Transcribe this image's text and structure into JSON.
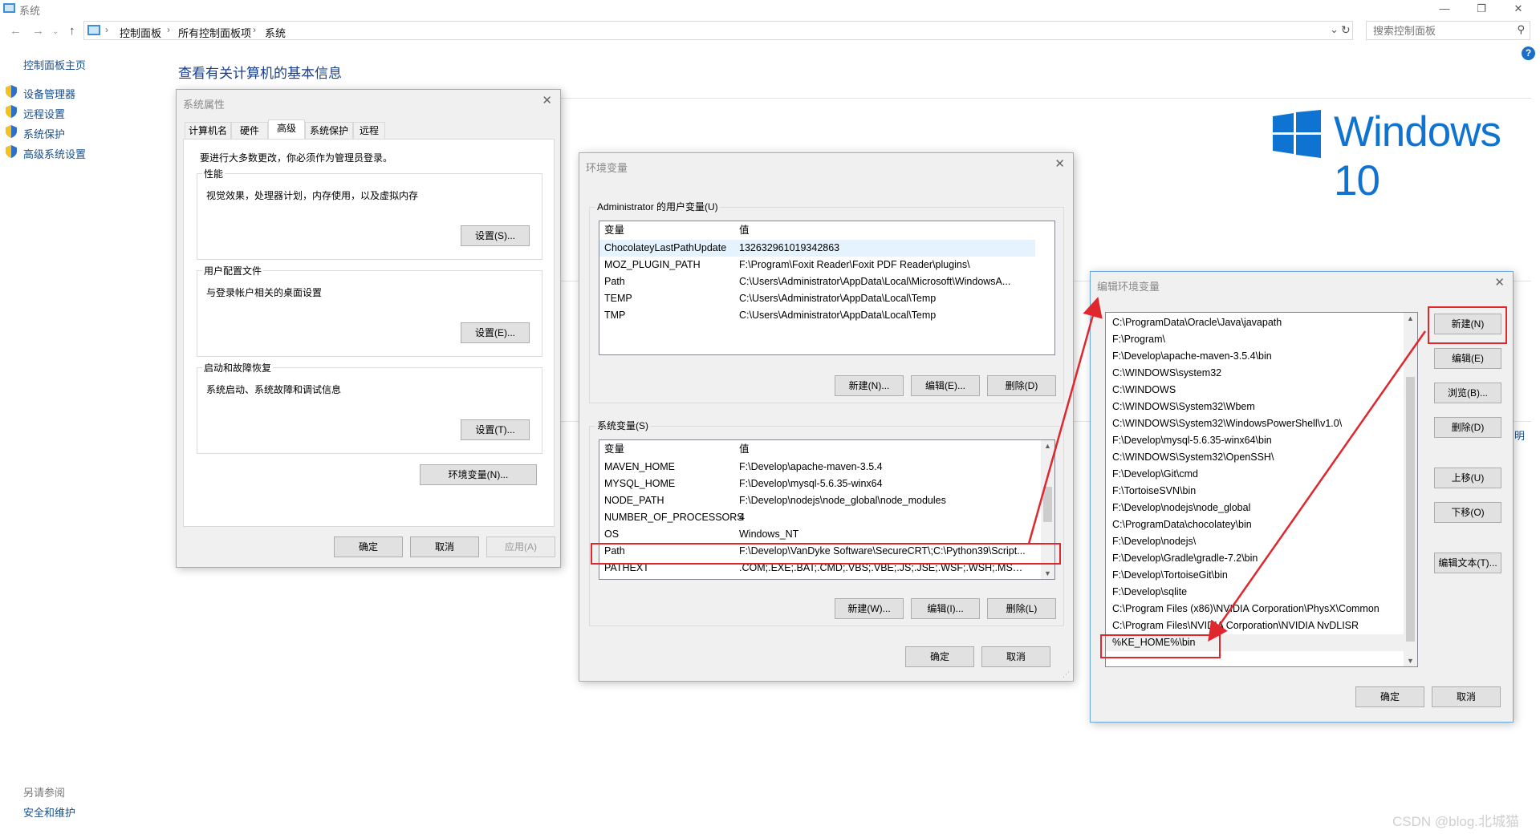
{
  "window": {
    "title": "系统",
    "controls": [
      "—",
      "❐",
      "✕"
    ]
  },
  "address": {
    "crumbs": [
      "控制面板",
      "所有控制面板项",
      "系统"
    ],
    "search_placeholder": "搜索控制面板"
  },
  "left_panel": {
    "home": "控制面板主页",
    "items": [
      "设备管理器",
      "远程设置",
      "系统保护",
      "高级系统设置"
    ],
    "see_also_title": "另请参阅",
    "see_also_items": [
      "安全和维护"
    ]
  },
  "main": {
    "title": "查看有关计算机的基本信息",
    "brand": "Windows 10",
    "edge_text": "明",
    "watermark": "CSDN @blog.北城猫"
  },
  "sysprops": {
    "title": "系统属性",
    "tabs": [
      "计算机名",
      "硬件",
      "高级",
      "系统保护",
      "远程"
    ],
    "active_tab": "高级",
    "admin_note": "要进行大多数更改，你必须作为管理员登录。",
    "groups": [
      {
        "title": "性能",
        "desc": "视觉效果，处理器计划，内存使用，以及虚拟内存",
        "button": "设置(S)..."
      },
      {
        "title": "用户配置文件",
        "desc": "与登录帐户相关的桌面设置",
        "button": "设置(E)..."
      },
      {
        "title": "启动和故障恢复",
        "desc": "系统启动、系统故障和调试信息",
        "button": "设置(T)..."
      }
    ],
    "env_button": "环境变量(N)...",
    "ok": "确定",
    "cancel": "取消",
    "apply": "应用(A)"
  },
  "envvars": {
    "title": "环境变量",
    "user_group": "Administrator 的用户变量(U)",
    "col_var": "变量",
    "col_val": "值",
    "user_vars": [
      {
        "name": "ChocolateyLastPathUpdate",
        "value": "132632961019342863"
      },
      {
        "name": "MOZ_PLUGIN_PATH",
        "value": "F:\\Program\\Foxit Reader\\Foxit PDF Reader\\plugins\\"
      },
      {
        "name": "Path",
        "value": "C:\\Users\\Administrator\\AppData\\Local\\Microsoft\\WindowsA..."
      },
      {
        "name": "TEMP",
        "value": "C:\\Users\\Administrator\\AppData\\Local\\Temp"
      },
      {
        "name": "TMP",
        "value": "C:\\Users\\Administrator\\AppData\\Local\\Temp"
      }
    ],
    "user_buttons": [
      "新建(N)...",
      "编辑(E)...",
      "删除(D)"
    ],
    "sys_group": "系统变量(S)",
    "sys_vars": [
      {
        "name": "MAVEN_HOME",
        "value": "F:\\Develop\\apache-maven-3.5.4"
      },
      {
        "name": "MYSQL_HOME",
        "value": "F:\\Develop\\mysql-5.6.35-winx64"
      },
      {
        "name": "NODE_PATH",
        "value": "F:\\Develop\\nodejs\\node_global\\node_modules"
      },
      {
        "name": "NUMBER_OF_PROCESSORS",
        "value": "4"
      },
      {
        "name": "OS",
        "value": "Windows_NT"
      },
      {
        "name": "Path",
        "value": "F:\\Develop\\VanDyke Software\\SecureCRT\\;C:\\Python39\\Script..."
      },
      {
        "name": "PATHEXT",
        "value": ".COM;.EXE;.BAT;.CMD;.VBS;.VBE;.JS;.JSE;.WSF;.WSH;.MSC;.PY;.P..."
      }
    ],
    "sys_buttons": [
      "新建(W)...",
      "编辑(I)...",
      "删除(L)"
    ],
    "ok": "确定",
    "cancel": "取消"
  },
  "editenv": {
    "title": "编辑环境变量",
    "paths": [
      "C:\\ProgramData\\Oracle\\Java\\javapath",
      "F:\\Program\\",
      "F:\\Develop\\apache-maven-3.5.4\\bin",
      "C:\\WINDOWS\\system32",
      "C:\\WINDOWS",
      "C:\\WINDOWS\\System32\\Wbem",
      "C:\\WINDOWS\\System32\\WindowsPowerShell\\v1.0\\",
      "F:\\Develop\\mysql-5.6.35-winx64\\bin",
      "C:\\WINDOWS\\System32\\OpenSSH\\",
      "F:\\Develop\\Git\\cmd",
      "F:\\TortoiseSVN\\bin",
      "F:\\Develop\\nodejs\\node_global",
      "C:\\ProgramData\\chocolatey\\bin",
      "F:\\Develop\\nodejs\\",
      "F:\\Develop\\Gradle\\gradle-7.2\\bin",
      "F:\\Develop\\TortoiseGit\\bin",
      "F:\\Develop\\sqlite",
      "C:\\Program Files (x86)\\NVIDIA Corporation\\PhysX\\Common",
      "C:\\Program Files\\NVIDIA Corporation\\NVIDIA NvDLISR",
      "%KE_HOME%\\bin"
    ],
    "buttons": [
      "新建(N)",
      "编辑(E)",
      "浏览(B)...",
      "删除(D)",
      "上移(U)",
      "下移(O)",
      "编辑文本(T)..."
    ],
    "ok": "确定",
    "cancel": "取消"
  },
  "colors": {
    "annotation_red": "#e0272d",
    "link_blue": "#1a4f8c",
    "win_blue": "#0f74d1"
  }
}
